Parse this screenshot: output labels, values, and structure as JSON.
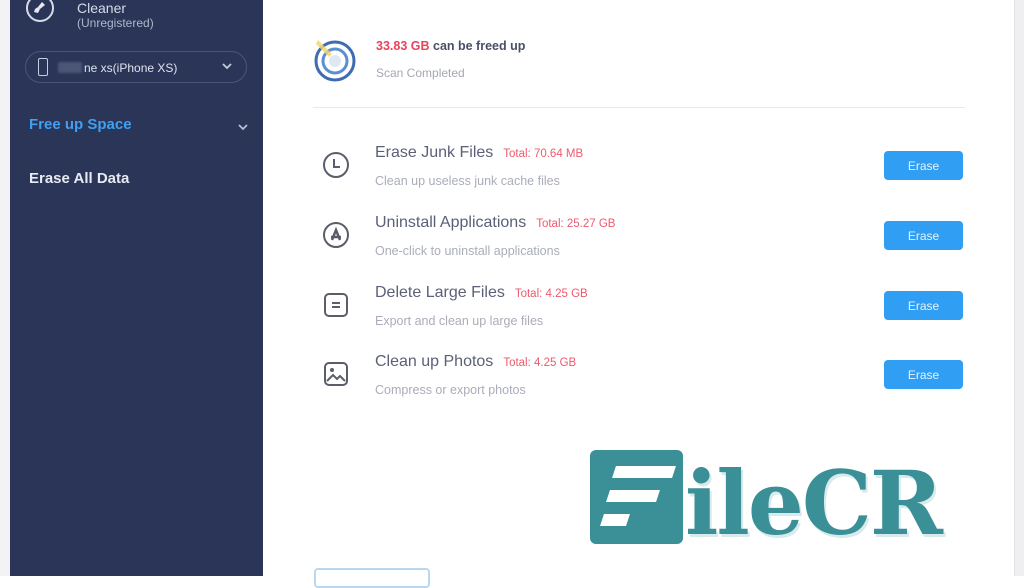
{
  "app": {
    "name": "Cleaner",
    "status": "(Unregistered)",
    "logo_icon": "broom-icon"
  },
  "device": {
    "icon": "phone-icon",
    "name": "ne xs(iPhone XS)",
    "dropdown_icon": "chevron-down-icon"
  },
  "sidebar": {
    "items": [
      {
        "label": "Free up Space",
        "active": true,
        "icon": "chevron-down-icon"
      },
      {
        "label": "Erase All Data",
        "active": false
      }
    ]
  },
  "scan": {
    "amount": "33.83 GB",
    "freed_text": " can be freed up",
    "status": "Scan Completed",
    "icon": "target-scan-icon"
  },
  "items": [
    {
      "title": "Erase Junk Files",
      "total": "Total: 70.64 MB",
      "desc": "Clean up useless junk cache files",
      "icon": "clock-icon",
      "button": "Erase"
    },
    {
      "title": "Uninstall Applications",
      "total": "Total: 25.27 GB",
      "desc": "One-click to uninstall applications",
      "icon": "app-store-icon",
      "button": "Erase"
    },
    {
      "title": "Delete Large Files",
      "total": "Total: 4.25 GB",
      "desc": "Export and clean up large files",
      "icon": "file-icon",
      "button": "Erase"
    },
    {
      "title": "Clean up Photos",
      "total": "Total: 4.25 GB",
      "desc": "Compress or export photos",
      "icon": "photo-icon",
      "button": "Erase"
    }
  ],
  "watermark": {
    "text": "ileCR",
    "color": "#3b8f97"
  },
  "colors": {
    "sidebar_bg": "#2b3558",
    "accent": "#2f9ef3",
    "danger": "#e8455a"
  }
}
